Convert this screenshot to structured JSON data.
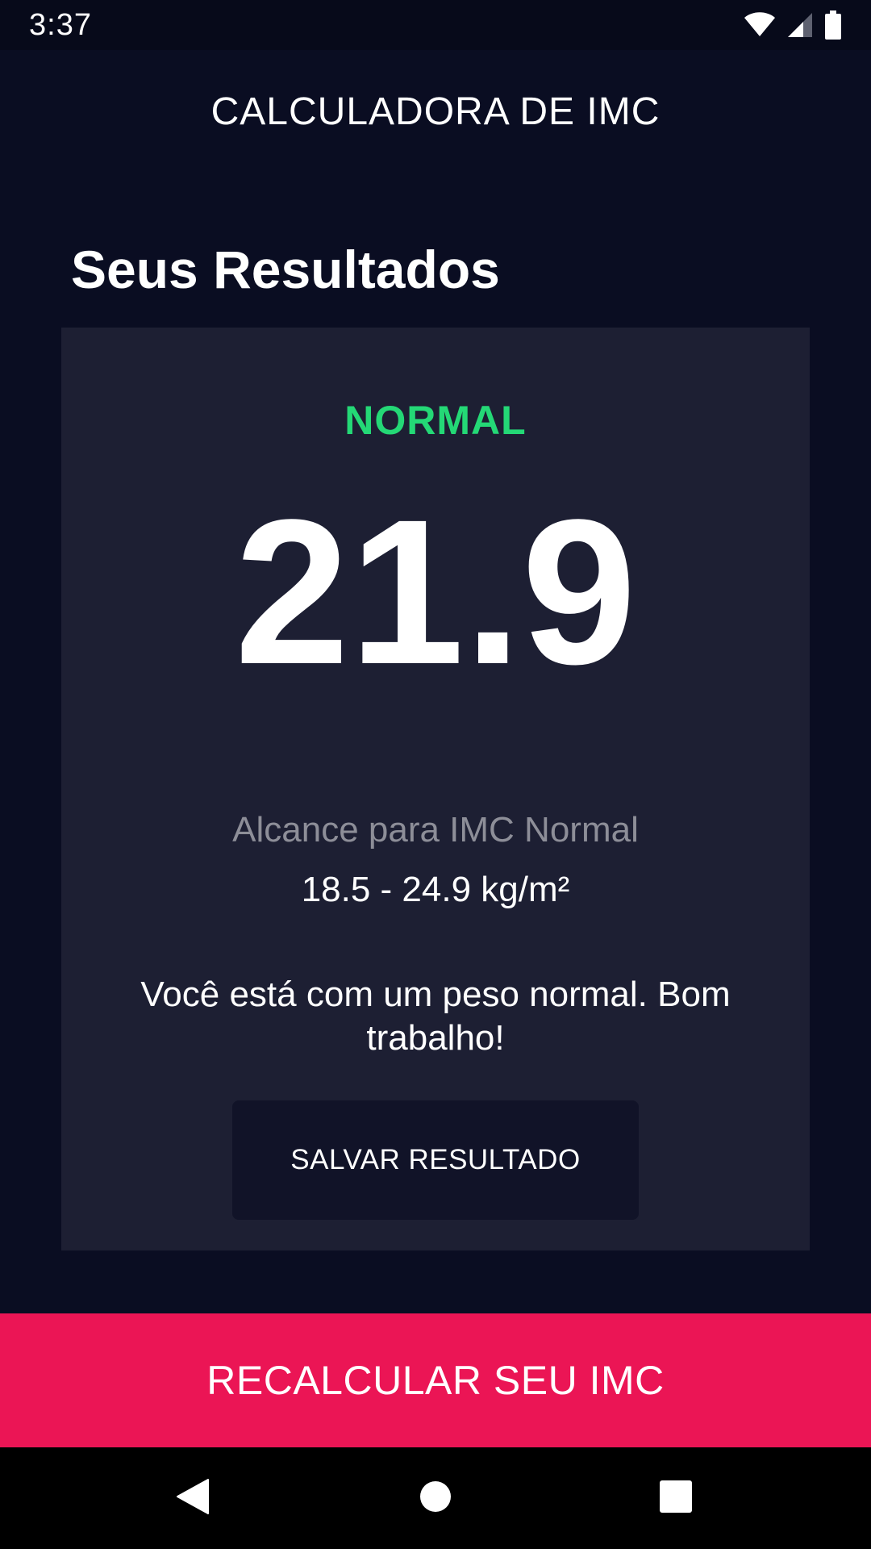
{
  "status_bar": {
    "time": "3:37",
    "icons": [
      "wifi-icon",
      "signal-icon",
      "battery-icon"
    ]
  },
  "app_bar": {
    "title": "CALCULADORA DE IMC"
  },
  "results": {
    "heading": "Seus Resultados",
    "status": "NORMAL",
    "bmi_value": "21.9",
    "range_label": "Alcance para IMC Normal",
    "range_value": "18.5 - 24.9 kg/m²",
    "interpretation": "Você está com um peso normal. Bom trabalho!",
    "save_label": "SALVAR RESULTADO"
  },
  "footer": {
    "recalculate_label": "RECALCULAR SEU IMC"
  },
  "navigation": {
    "buttons": [
      "back-icon",
      "home-icon",
      "recents-icon"
    ]
  },
  "colors": {
    "background": "#0A0D22",
    "card": "#1D1F33",
    "status_green": "#24D876",
    "accent_pink": "#EB1555",
    "muted_text": "#8D8E98"
  }
}
